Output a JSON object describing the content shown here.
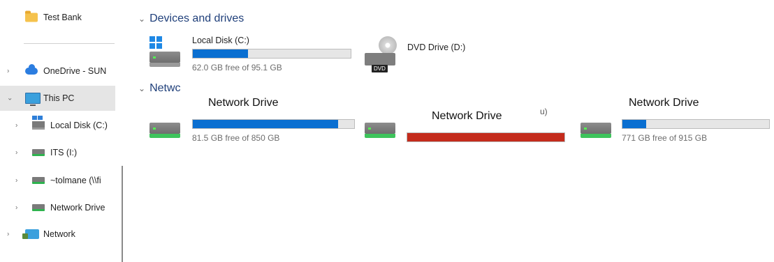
{
  "sidebar": {
    "items": [
      {
        "label": "Test Bank"
      },
      {
        "label": "OneDrive - SUN"
      },
      {
        "label": "This PC"
      },
      {
        "label": "Local Disk (C:)"
      },
      {
        "label": "ITS (I:)"
      },
      {
        "label": "~tolmane (\\\\fi"
      },
      {
        "label": "Network Drive"
      },
      {
        "label": "Network"
      }
    ]
  },
  "main": {
    "devices_header": "Devices and drives",
    "network_header": "Netwc",
    "local_disk": {
      "name": "Local Disk (C:)",
      "free_text": "62.0 GB free of 95.1 GB",
      "used_fraction": 0.35
    },
    "dvd": {
      "name": "DVD Drive (D:)",
      "tag": "DVD"
    },
    "net1": {
      "overlay": "Network Drive",
      "free_text": "81.5 GB free of 850 GB",
      "used_fraction": 0.9
    },
    "net2": {
      "overlay": "Network Drive",
      "fragment": "u)",
      "used_fraction": 1.0
    },
    "net3": {
      "overlay": "Network Drive",
      "free_text": "771 GB free of 915 GB",
      "used_fraction": 0.16
    }
  },
  "colors": {
    "bar_blue": "#0a6fd1",
    "bar_red": "#c42b1c",
    "selected_bg": "#e5e5e5"
  }
}
